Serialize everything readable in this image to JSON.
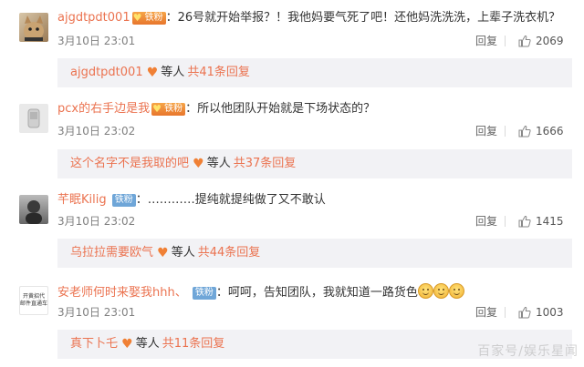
{
  "comments": [
    {
      "user": "ajgdtpdt001",
      "badge": "铁粉",
      "text": "：26号就开始举报？！我他妈要气死了吧！还他妈洗洗洗，上辈子洗衣机？",
      "time": "3月10日 23:01",
      "reply": "回复",
      "likes": "2069",
      "sub_user": "ajgdtpdt001",
      "sub_deng": "等人",
      "sub_count": "共41条回复"
    },
    {
      "user": "pcx的右手边是我",
      "badge": "铁粉",
      "text": "：所以他团队开始就是下场状态的？",
      "time": "3月10日 23:02",
      "reply": "回复",
      "likes": "1666",
      "sub_user": "这个名字不是我取的吧",
      "sub_deng": "等人",
      "sub_count": "共37条回复"
    },
    {
      "user": "芊眠Kilig",
      "badge": "铁粉",
      "text": "：…………提纯就提纯做了又不敢认",
      "time": "3月10日 23:02",
      "reply": "回复",
      "likes": "1415",
      "sub_user": "乌拉拉需要欧气",
      "sub_deng": "等人",
      "sub_count": "共44条回复"
    },
    {
      "user": "安老师何时来娶我hhh、",
      "badge": "铁粉",
      "text": "：呵呵，告知团队，我就知道一路货色",
      "time": "3月10日 23:01",
      "reply": "回复",
      "likes": "1003",
      "sub_user": "真下卜乇",
      "sub_deng": "等人",
      "sub_count": "共11条回复"
    }
  ],
  "watermark": "百家号/娱乐星闻",
  "avatar4_text": "开黄招代 邮件直通车",
  "colors": {
    "accent": "#eb7350",
    "sub_bg": "#f2f2f5",
    "badge_blue": "#6fa6d8"
  }
}
